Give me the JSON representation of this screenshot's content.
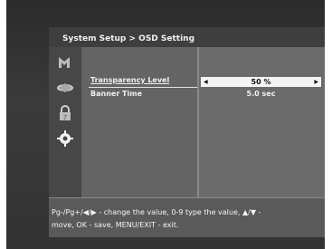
{
  "header": {
    "breadcrumb": "System Setup > OSD Setting"
  },
  "sidebar": {
    "icons": [
      {
        "name": "cursor-icon"
      },
      {
        "name": "satellite-icon"
      },
      {
        "name": "lock-icon"
      },
      {
        "name": "gear-icon"
      }
    ]
  },
  "settings": [
    {
      "label": "Transparency Level",
      "value": "50 %",
      "selected": true
    },
    {
      "label": "Banner Time",
      "value": "5.0 sec",
      "selected": false
    }
  ],
  "help": {
    "text": "Pg-/Pg+/◀/▶ - change the value, 0-9 type the value, ▲/▼ -\nmove, OK - save, MENU/EXIT - exit."
  },
  "colors": {
    "selected_bg": "#f4f4f4",
    "panel_bg": "#555555"
  }
}
